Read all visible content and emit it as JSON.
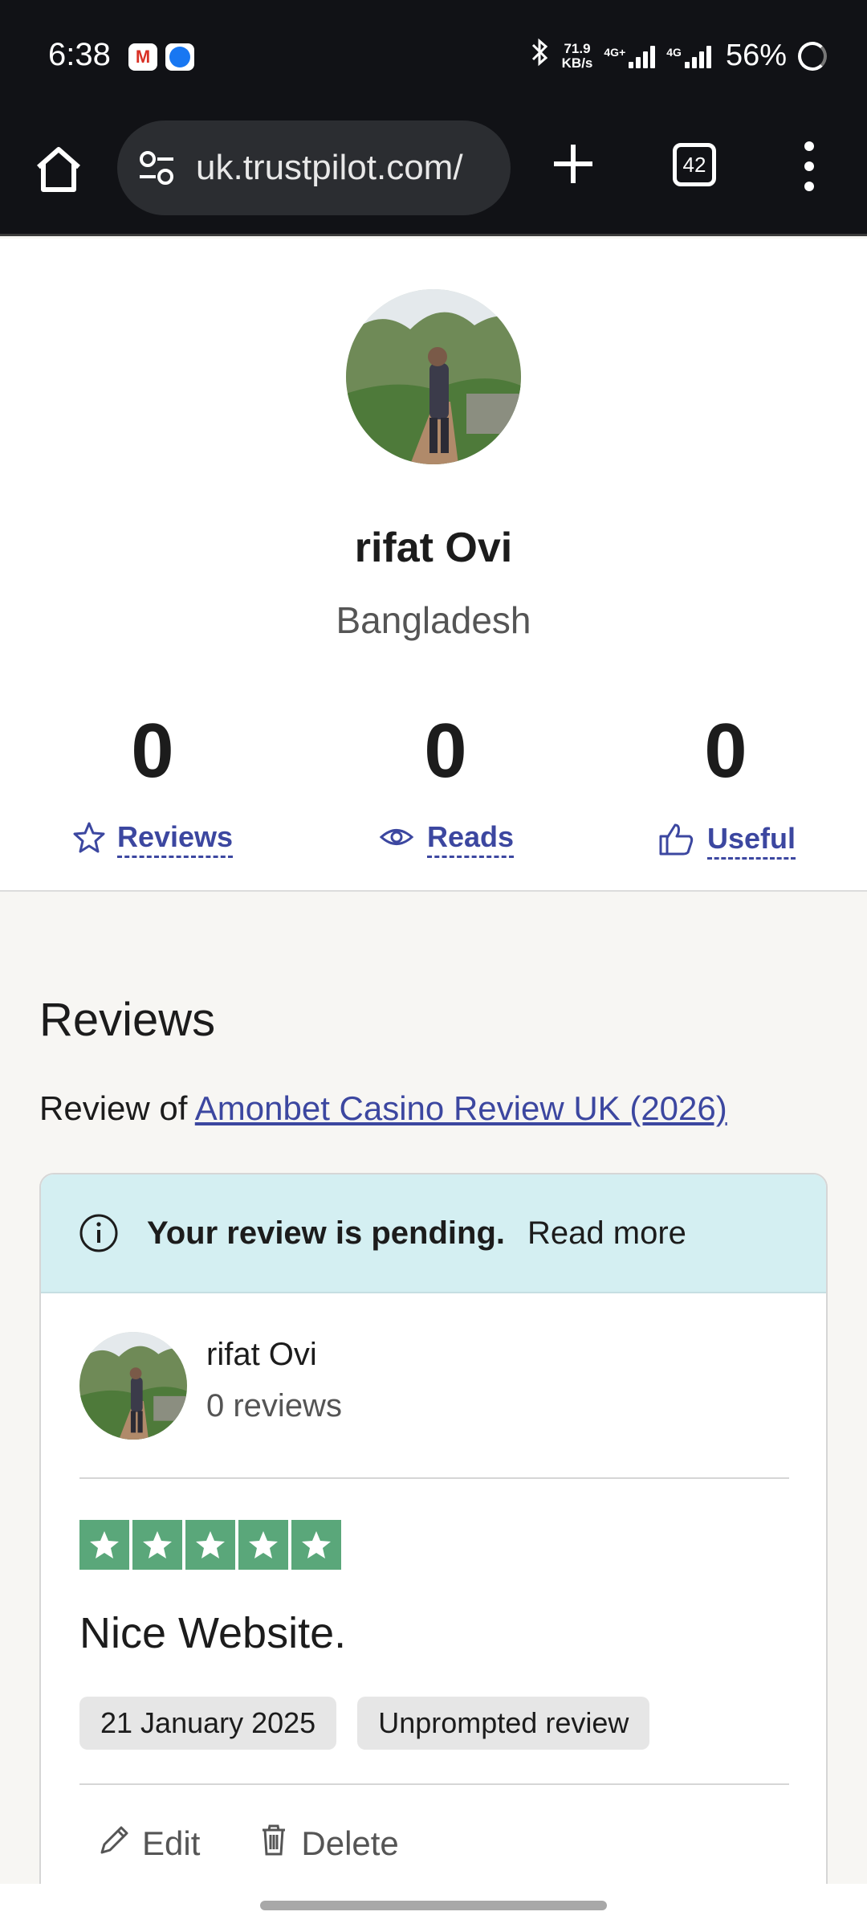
{
  "status_bar": {
    "time": "6:38",
    "net_speed_value": "71.9",
    "net_speed_unit": "KB/s",
    "signal1_label": "4G+",
    "signal2_label": "4G",
    "battery": "56%",
    "icons": [
      "gmail-icon",
      "messenger-icon",
      "bluetooth-icon",
      "signal-icon",
      "battery-icon"
    ]
  },
  "browser": {
    "url": "uk.trustpilot.com/",
    "tab_count": "42",
    "icons": [
      "home-icon",
      "site-settings-icon",
      "plus-icon",
      "tabs-icon",
      "more-vert-icon"
    ]
  },
  "profile": {
    "name": "rifat Ovi",
    "country": "Bangladesh",
    "stats": [
      {
        "value": "0",
        "label": "Reviews",
        "icon": "star-outline-icon"
      },
      {
        "value": "0",
        "label": "Reads",
        "icon": "eye-icon"
      },
      {
        "value": "0",
        "label": "Useful",
        "icon": "thumbs-up-icon"
      }
    ]
  },
  "reviews": {
    "heading": "Reviews",
    "review_of_prefix": "Review of ",
    "review_of_link": "Amonbet Casino Review UK (2026)",
    "banner": {
      "pending_text": "Your review is pending.",
      "read_more": "Read more"
    },
    "reviewer": {
      "name": "rifat Ovi",
      "count": "0 reviews"
    },
    "rating": 5,
    "title": "Nice Website.",
    "date": "21 January 2025",
    "tag": "Unprompted review",
    "edit_label": "Edit",
    "delete_label": "Delete",
    "colors": {
      "star_green": "#5aa77a",
      "link_blue": "#3c47a0",
      "banner_bg": "#d4eff2"
    }
  }
}
